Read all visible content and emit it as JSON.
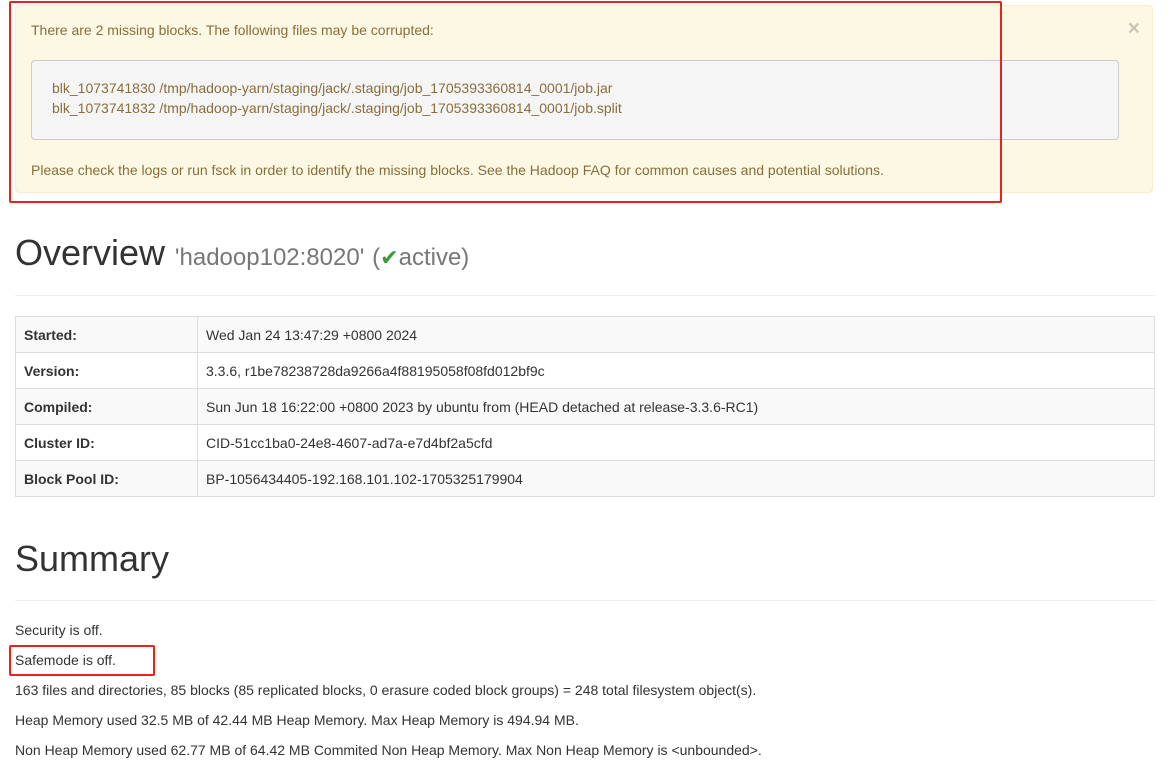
{
  "alert": {
    "intro": "There are 2 missing blocks. The following files may be corrupted:",
    "close_label": "×",
    "blocks": [
      "blk_1073741830 /tmp/hadoop-yarn/staging/jack/.staging/job_1705393360814_0001/job.jar",
      "blk_1073741832 /tmp/hadoop-yarn/staging/jack/.staging/job_1705393360814_0001/job.split"
    ],
    "footer": "Please check the logs or run fsck in order to identify the missing blocks. See the Hadoop FAQ for common causes and potential solutions."
  },
  "overview": {
    "title": "Overview",
    "host": "'hadoop102:8020'",
    "state_open": "(",
    "state_icon": "✔",
    "state": "active)",
    "rows": [
      {
        "key": "Started:",
        "value": "Wed Jan 24 13:47:29 +0800 2024"
      },
      {
        "key": "Version:",
        "value": "3.3.6, r1be78238728da9266a4f88195058f08fd012bf9c"
      },
      {
        "key": "Compiled:",
        "value": "Sun Jun 18 16:22:00 +0800 2023 by ubuntu from (HEAD detached at release-3.3.6-RC1)"
      },
      {
        "key": "Cluster ID:",
        "value": "CID-51cc1ba0-24e8-4607-ad7a-e7d4bf2a5cfd"
      },
      {
        "key": "Block Pool ID:",
        "value": "BP-1056434405-192.168.101.102-1705325179904"
      }
    ]
  },
  "summary": {
    "title": "Summary",
    "lines": [
      "Security is off.",
      "Safemode is off.",
      "163 files and directories, 85 blocks (85 replicated blocks, 0 erasure coded block groups) = 248 total filesystem object(s).",
      "Heap Memory used 32.5 MB of 42.44 MB Heap Memory. Max Heap Memory is 494.94 MB.",
      "Non Heap Memory used 62.77 MB of 64.42 MB Commited Non Heap Memory. Max Non Heap Memory is <unbounded>."
    ]
  },
  "colors": {
    "alert_bg": "#fcf8e3",
    "alert_text": "#8a6d3b",
    "highlight": "#e8231d",
    "check": "#3c9a3c"
  }
}
